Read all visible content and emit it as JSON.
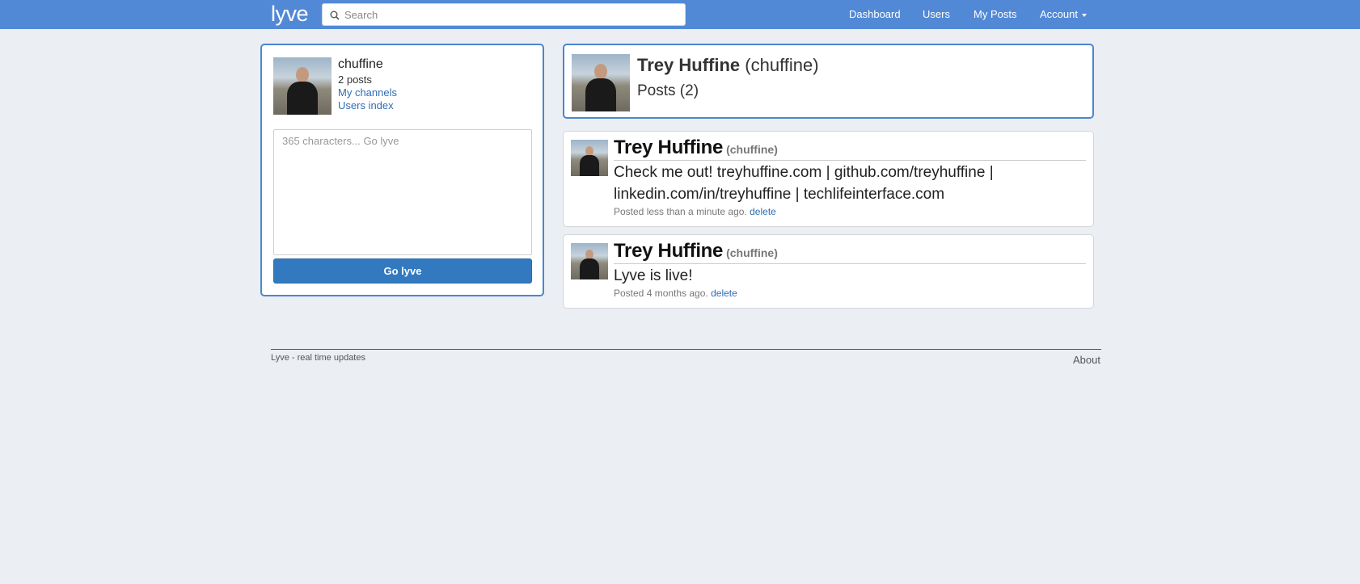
{
  "navbar": {
    "brand": "lyve",
    "search_placeholder": "Search",
    "links": {
      "dashboard": "Dashboard",
      "users": "Users",
      "my_posts": "My Posts",
      "account": "Account"
    },
    "colors": {
      "background": "#5289d6"
    }
  },
  "sidebar": {
    "username": "chuffine",
    "post_count": "2 posts",
    "link_channels": "My channels",
    "link_users_index": "Users index",
    "compose_placeholder": "365 characters... Go lyve",
    "submit_label": "Go lyve"
  },
  "profile": {
    "full_name": "Trey Huffine",
    "username": "(chuffine)",
    "posts_heading": "Posts (2)"
  },
  "posts": [
    {
      "author": "Trey Huffine",
      "username": "(chuffine)",
      "content": "Check me out! treyhuffine.com | github.com/treyhuffine | linkedin.com/in/treyhuffine | techlifeinterface.com",
      "timestamp": "Posted less than a minute ago.",
      "delete_label": "delete"
    },
    {
      "author": "Trey Huffine",
      "username": "(chuffine)",
      "content": "Lyve is live!",
      "timestamp": "Posted 4 months ago.",
      "delete_label": "delete"
    }
  ],
  "footer": {
    "tagline": "Lyve - real time updates",
    "about": "About"
  },
  "icons": {
    "search": "search-icon",
    "account_caret": "caret-down-icon"
  }
}
